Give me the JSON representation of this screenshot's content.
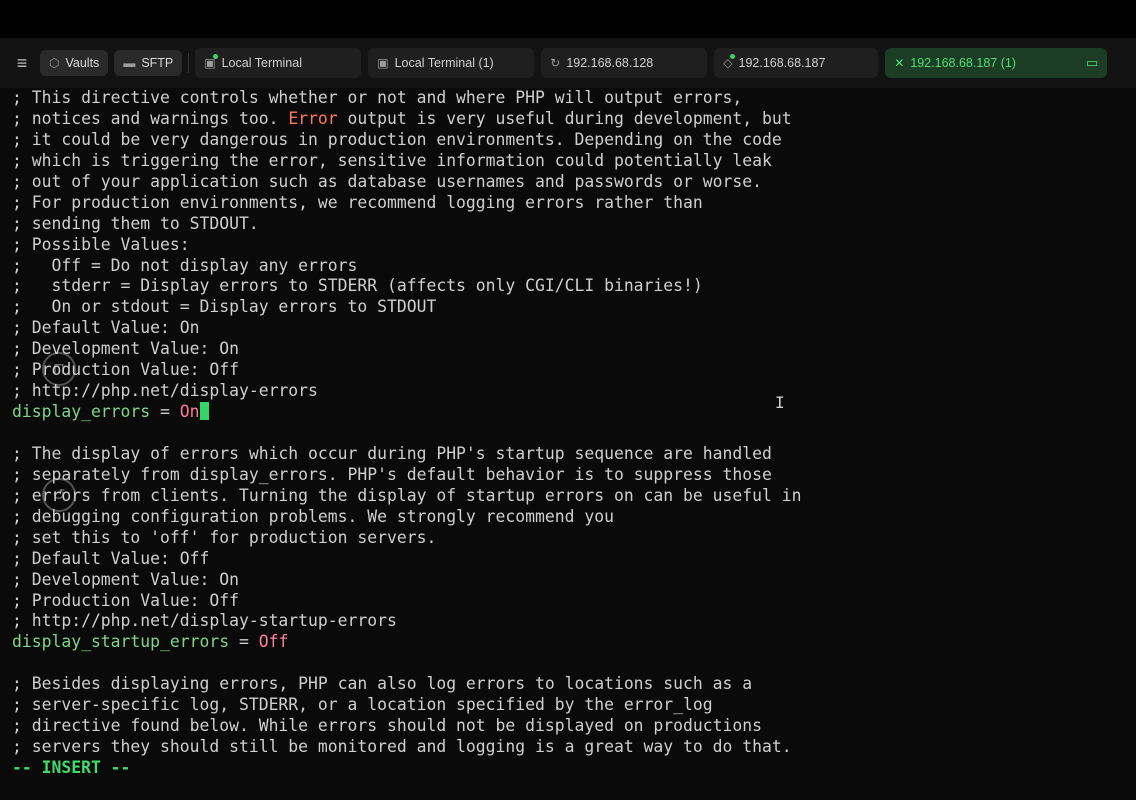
{
  "tabbar": {
    "pills": [
      {
        "label": "Vaults",
        "icon": "vault-icon"
      },
      {
        "label": "SFTP",
        "icon": "folder-icon"
      }
    ],
    "tabs": [
      {
        "label": "Local Terminal",
        "icon": "terminal-icon",
        "connected": true
      },
      {
        "label": "Local Terminal (1)",
        "icon": "terminal-icon",
        "connected": false
      },
      {
        "label": "192.168.68.128",
        "icon": "refresh-icon",
        "connected": false
      },
      {
        "label": "192.168.68.187",
        "icon": "server-icon",
        "connected": true
      },
      {
        "label": "192.168.68.187 (1)",
        "icon": "close-icon",
        "connected": true,
        "active": true
      }
    ]
  },
  "terminal": {
    "lines": [
      {
        "text": "; This directive controls whether or not and where PHP will output errors,"
      },
      {
        "pre": "; notices and warnings too. ",
        "hl": "Error",
        "post": " output is very useful during development, but"
      },
      {
        "text": "; it could be very dangerous in production environments. Depending on the code"
      },
      {
        "text": "; which is triggering the error, sensitive information could potentially leak"
      },
      {
        "text": "; out of your application such as database usernames and passwords or worse."
      },
      {
        "text": "; For production environments, we recommend logging errors rather than"
      },
      {
        "text": "; sending them to STDOUT."
      },
      {
        "text": "; Possible Values:"
      },
      {
        "text": ";   Off = Do not display any errors"
      },
      {
        "text": ";   stderr = Display errors to STDERR (affects only CGI/CLI binaries!)"
      },
      {
        "text": ";   On or stdout = Display errors to STDOUT"
      },
      {
        "text": "; Default Value: On"
      },
      {
        "text": "; Development Value: On"
      },
      {
        "text": "; Production Value: Off"
      },
      {
        "text": "; http://php.net/display-errors"
      },
      {
        "key": "display_errors",
        "eq": " = ",
        "value": "On",
        "cursor": true
      },
      {
        "text": ""
      },
      {
        "text": "; The display of errors which occur during PHP's startup sequence are handled"
      },
      {
        "text": "; separately from display_errors. PHP's default behavior is to suppress those"
      },
      {
        "text": "; errors from clients. Turning the display of startup errors on can be useful in"
      },
      {
        "text": "; debugging configuration problems. We strongly recommend you"
      },
      {
        "text": "; set this to 'off' for production servers."
      },
      {
        "text": "; Default Value: Off"
      },
      {
        "text": "; Development Value: On"
      },
      {
        "text": "; Production Value: Off"
      },
      {
        "text": "; http://php.net/display-startup-errors"
      },
      {
        "key": "display_startup_errors",
        "eq": " = ",
        "value": "Off"
      },
      {
        "text": ""
      },
      {
        "text": "; Besides displaying errors, PHP can also log errors to locations such as a"
      },
      {
        "text": "; server-specific log, STDERR, or a location specified by the error_log"
      },
      {
        "text": "; directive found below. While errors should not be displayed on productions"
      },
      {
        "text": "; servers they should still be monitored and logging is a great way to do that."
      }
    ],
    "mode": "-- INSERT --"
  },
  "colors": {
    "active_tab_bg": "#1c3c24",
    "active_tab_fg": "#4ee07a",
    "key": "#7fd686",
    "value": "#ff7b9a",
    "error_word": "#ff7a59",
    "cursor": "#35d46b"
  }
}
